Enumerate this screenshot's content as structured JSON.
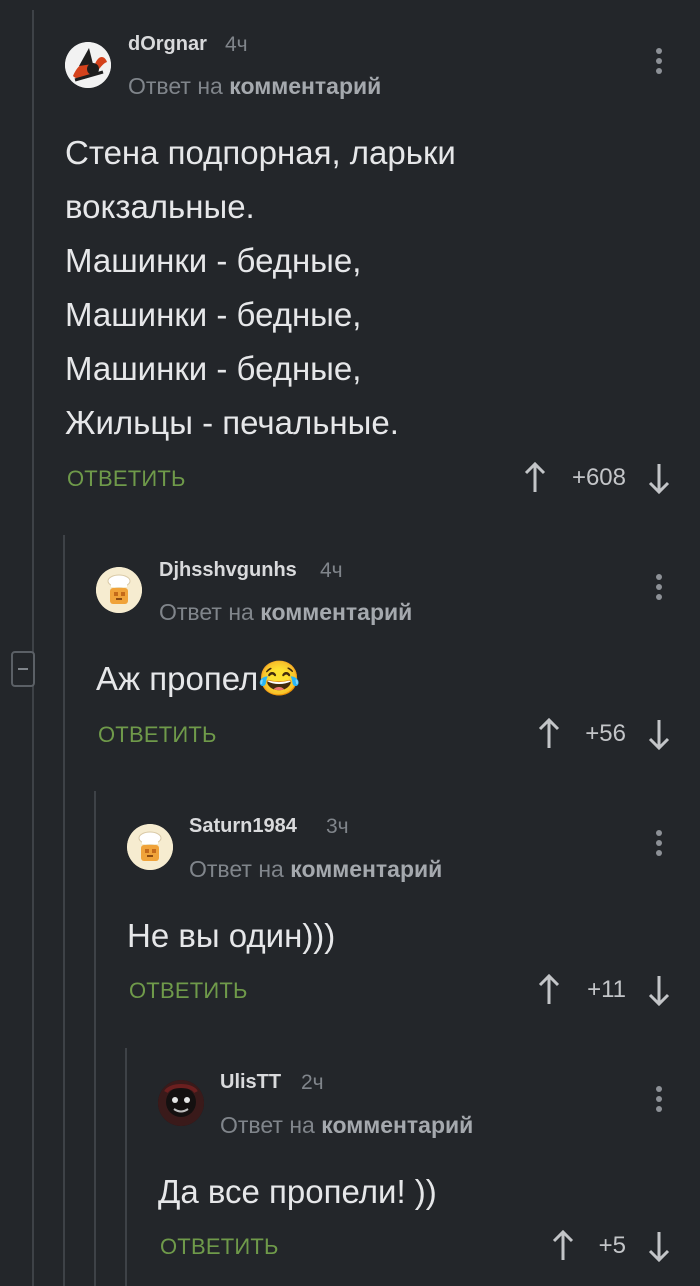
{
  "comments": [
    {
      "username": "dOrgnar",
      "time": "4ч",
      "reply_prefix": "Ответ на",
      "reply_target": "комментарий",
      "body_lines": [
        "Стена подпорная, ларьки",
        "вокзальные.",
        "Машинки - бедные,",
        "Машинки - бедные,",
        "Машинки - бедные,",
        "Жильцы - печальные."
      ],
      "reply_label": "ОТВЕТИТЬ",
      "score": "+608",
      "avatar_icon": "witch-avatar-icon"
    },
    {
      "username": "Djhsshvgunhs",
      "time": "4ч",
      "reply_prefix": "Ответ на",
      "reply_target": "комментарий",
      "body_lines": [
        "Аж пропел"
      ],
      "emoji": "😂",
      "reply_label": "ОТВЕТИТЬ",
      "score": "+56",
      "avatar_icon": "cook-avatar-icon"
    },
    {
      "username": "Saturn1984",
      "time": "3ч",
      "reply_prefix": "Ответ на",
      "reply_target": "комментарий",
      "body_lines": [
        "Не вы один)))"
      ],
      "reply_label": "ОТВЕТИТЬ",
      "score": "+11",
      "avatar_icon": "cook-avatar-icon"
    },
    {
      "username": "UlisTT",
      "time": "2ч",
      "reply_prefix": "Ответ на",
      "reply_target": "комментарий",
      "body_lines": [
        "Да все пропели! ))"
      ],
      "reply_label": "ОТВЕТИТЬ",
      "score": "+5",
      "avatar_icon": "dark-face-avatar-icon"
    }
  ],
  "colors": {
    "background": "#23262a",
    "reply_green": "#6f9a4a",
    "thread_line": "#3e4247"
  }
}
